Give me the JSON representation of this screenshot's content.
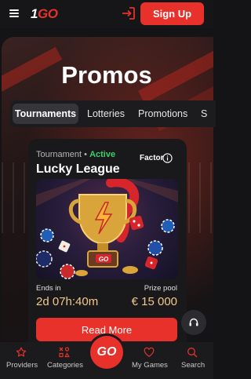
{
  "header": {
    "logo_prefix": "1",
    "logo_suffix": "GO",
    "signup_label": "Sign Up"
  },
  "hero": {
    "title": "Promos"
  },
  "tabs": [
    {
      "label": "Tournaments",
      "active": true
    },
    {
      "label": "Lotteries",
      "active": false
    },
    {
      "label": "Promotions",
      "active": false
    },
    {
      "label": "S",
      "active": false
    }
  ],
  "card": {
    "category": "Tournament",
    "separator": "•",
    "status": "Active",
    "provider": "Factor",
    "title": "Lucky League",
    "ends_label": "Ends in",
    "ends_value": "2d 07h:40m",
    "prize_label": "Prize pool",
    "prize_value": "€ 15 000",
    "cta_label": "Read More",
    "image_badge": "GO"
  },
  "bottom_nav": [
    {
      "label": "Providers",
      "icon": "star-icon"
    },
    {
      "label": "Categories",
      "icon": "grid-shapes-icon"
    },
    {
      "label": "GO",
      "icon": "go-icon"
    },
    {
      "label": "My Games",
      "icon": "heart-icon"
    },
    {
      "label": "Search",
      "icon": "search-icon"
    }
  ],
  "colors": {
    "accent": "#e8312a",
    "active_status": "#3ecf6a",
    "gold_text": "#f2c98a",
    "background": "#141416"
  }
}
